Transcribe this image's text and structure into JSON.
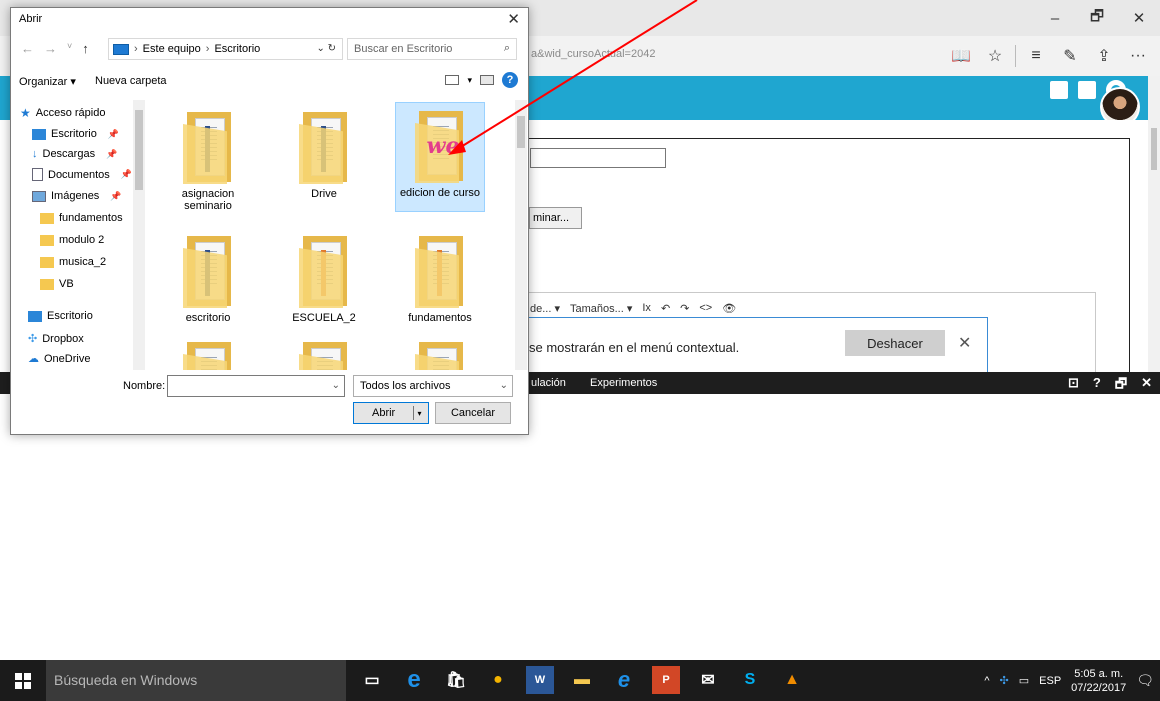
{
  "browser": {
    "url_fragment": "a&wid_cursoActual=2042",
    "window_controls": [
      "–",
      "🗗",
      "✕"
    ],
    "toolbar_icons": [
      "reading-view-icon",
      "favorite-star-icon",
      "hub-icon",
      "notes-pen-icon",
      "share-icon",
      "more-icon"
    ],
    "more_label": "···"
  },
  "site": {
    "editor_toolbar": [
      "de... ▾",
      "Tamaños... ▾",
      "Ix",
      "↶",
      "↷",
      "<>",
      "👁"
    ],
    "eliminar_label": "minar...",
    "notification_text": "se mostrarán en el menú contextual.",
    "undo_label": "Deshacer",
    "close_label": "✕",
    "header_color": "#1fa6d0"
  },
  "devtools": {
    "tab1": "ulación",
    "tab2": "Experimentos",
    "right_icons": [
      "⊡",
      "?",
      "🗗",
      "✕"
    ]
  },
  "dialog": {
    "title": "Abrir",
    "close": "✕",
    "breadcrumb": [
      "Este equipo",
      "Escritorio"
    ],
    "search_placeholder": "Buscar en Escritorio",
    "organize_label": "Organizar ▾",
    "new_folder_label": "Nueva carpeta",
    "nav_items": [
      {
        "label": "Acceso rápido",
        "icon": "star-icon",
        "pinned": false
      },
      {
        "label": "Escritorio",
        "icon": "desktop-icon",
        "pinned": true
      },
      {
        "label": "Descargas",
        "icon": "download-icon",
        "pinned": true
      },
      {
        "label": "Documentos",
        "icon": "documents-icon",
        "pinned": true
      },
      {
        "label": "Imágenes",
        "icon": "pictures-icon",
        "pinned": true
      },
      {
        "label": "fundamentos",
        "icon": "folder-icon",
        "pinned": false
      },
      {
        "label": "modulo 2",
        "icon": "folder-icon",
        "pinned": false
      },
      {
        "label": "musica_2",
        "icon": "folder-icon",
        "pinned": false
      },
      {
        "label": "VB",
        "icon": "folder-icon",
        "pinned": false
      },
      {
        "label": "Escritorio",
        "icon": "desktop-icon",
        "pinned": false
      },
      {
        "label": "Dropbox",
        "icon": "dropbox-icon",
        "pinned": false
      },
      {
        "label": "OneDrive",
        "icon": "onedrive-icon",
        "pinned": false
      }
    ],
    "files": [
      {
        "label": "asignacion seminario",
        "selected": false
      },
      {
        "label": "Drive",
        "selected": false
      },
      {
        "label": "edicion de curso",
        "selected": true
      },
      {
        "label": "escritorio",
        "selected": false
      },
      {
        "label": "ESCUELA_2",
        "selected": false
      },
      {
        "label": "fundamentos",
        "selected": false
      },
      {
        "label": "",
        "selected": false
      },
      {
        "label": "",
        "selected": false
      },
      {
        "label": "",
        "selected": false
      }
    ],
    "name_label": "Nombre:",
    "name_value": "",
    "file_type": "Todos los archivos",
    "open_label": "Abrir",
    "cancel_label": "Cancelar"
  },
  "taskbar": {
    "search_text": "Búsqueda en Windows",
    "apps": [
      "task-view-icon",
      "edge-icon",
      "store-icon",
      "chrome-icon",
      "word-icon",
      "explorer-icon",
      "ie-icon",
      "powerpoint-icon",
      "mail-icon",
      "skype-icon",
      "vlc-icon"
    ],
    "language": "ESP",
    "time": "5:05 a. m.",
    "date": "07/22/2017",
    "tray_caret": "^",
    "notification_count": "1"
  },
  "annotation": {
    "arrow_color": "#ff0000"
  }
}
